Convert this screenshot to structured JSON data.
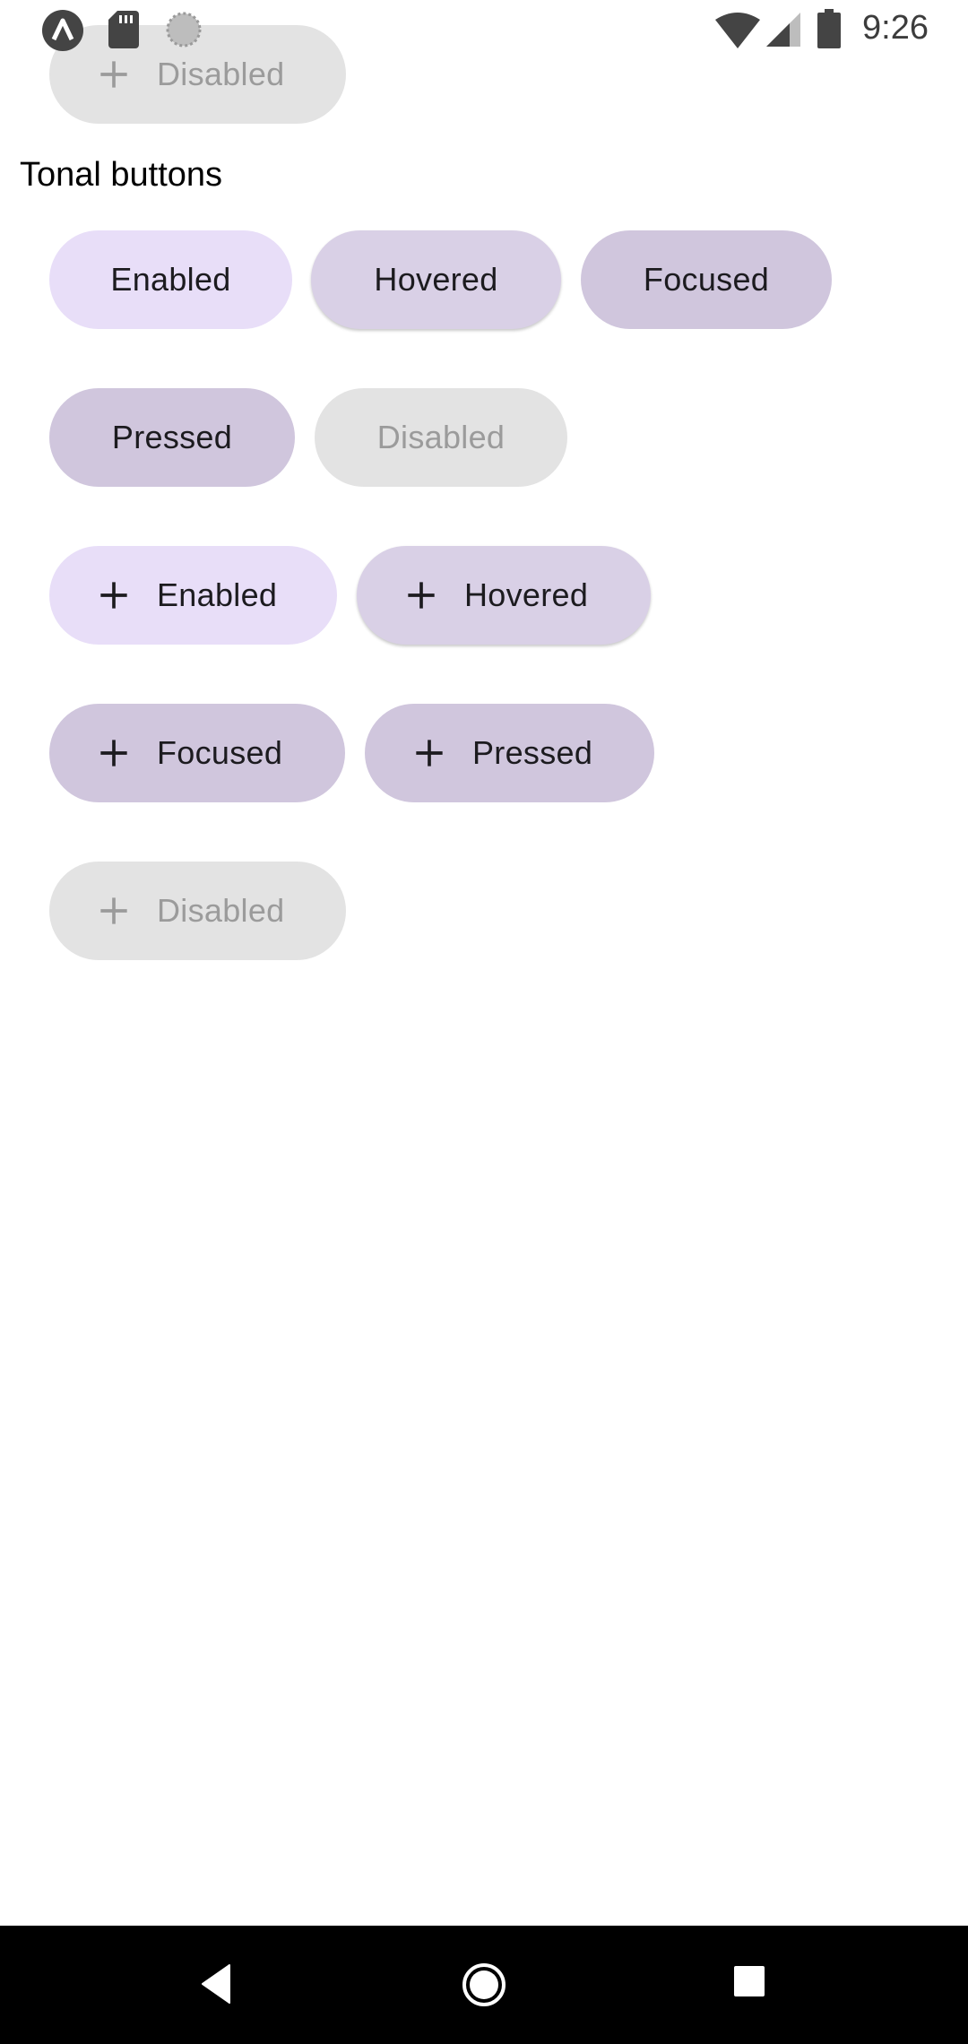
{
  "status_bar": {
    "time": "9:26",
    "icons": [
      "app-notification-icon",
      "sd-card-icon",
      "sync-icon",
      "wifi-icon",
      "signal-icon",
      "battery-icon"
    ]
  },
  "top_partial_button": {
    "label": "Disabled",
    "icon": "plus-icon"
  },
  "section": {
    "title": "Tonal buttons"
  },
  "text_buttons": [
    {
      "label": "Enabled",
      "state": "enabled"
    },
    {
      "label": "Hovered",
      "state": "hovered"
    },
    {
      "label": "Focused",
      "state": "focused"
    },
    {
      "label": "Pressed",
      "state": "pressed"
    },
    {
      "label": "Disabled",
      "state": "disabled"
    }
  ],
  "icon_buttons": [
    {
      "label": "Enabled",
      "state": "enabled",
      "icon": "plus-icon"
    },
    {
      "label": "Hovered",
      "state": "hovered",
      "icon": "plus-icon"
    },
    {
      "label": "Focused",
      "state": "focused",
      "icon": "plus-icon"
    },
    {
      "label": "Pressed",
      "state": "pressed",
      "icon": "plus-icon"
    },
    {
      "label": "Disabled",
      "state": "disabled",
      "icon": "plus-icon"
    }
  ],
  "colors": {
    "enabled": "#e8def8",
    "hovered": "#d9d0e6",
    "focused": "#d0c6dd",
    "pressed": "#d0c6dd",
    "disabled": "#e3e3e3",
    "disabled_text": "#9b9b9b",
    "on_container": "#1c1b1f"
  },
  "nav_bar": {
    "buttons": [
      "back-icon",
      "home-icon",
      "recents-icon"
    ]
  }
}
